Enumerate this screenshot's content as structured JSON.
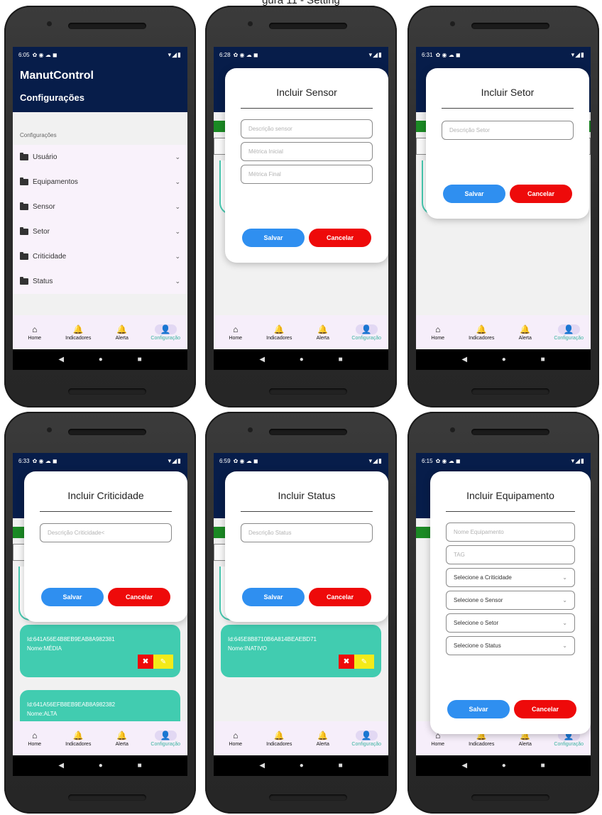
{
  "caption": "gura 11 - Setting",
  "status": {
    "icons_left": "✿ ◉ ☁ ◼",
    "icons_right": "▾◢▮",
    "times": [
      "6:05",
      "6:28",
      "6:31",
      "6:33",
      "6:59",
      "6:15"
    ]
  },
  "app": {
    "title": "ManutControl",
    "subtitle": "Configurações"
  },
  "config": {
    "section_label": "Configurações",
    "items": [
      "Usuário",
      "Equipamentos",
      "Sensor",
      "Setor",
      "Criticidade",
      "Status"
    ]
  },
  "nav": {
    "home": "Home",
    "indicadores": "Indicadores",
    "alerta": "Alerta",
    "configuracao": "Configuração"
  },
  "buttons": {
    "save": "Salvar",
    "cancel": "Cancelar"
  },
  "modals": {
    "sensor": {
      "title": "Incluir Sensor",
      "desc_placeholder": "Descrição sensor",
      "metric_start": "Métrica Inicial",
      "metric_end": "Métrica Final"
    },
    "setor": {
      "title": "Incluir Setor",
      "desc_placeholder": "Descrição Setor"
    },
    "criticidade": {
      "title": "Incluir Criticidade",
      "desc_placeholder": "Descrição Criticidade<"
    },
    "status": {
      "title": "Incluir Status",
      "desc_placeholder": "Descrição Status"
    },
    "equipamento": {
      "title": "Incluir Equipamento",
      "name_placeholder": "Nome Equipamento",
      "tag_placeholder": "TAG",
      "sel_criticidade": "Selecione a Criticidade",
      "sel_sensor": "Selecione o Sensor",
      "sel_setor": "Selecione o Setor",
      "sel_status": "Selecione o Status"
    }
  },
  "cards": {
    "crit1": {
      "id": "Id:641A56E4B8EB9EAB8A982381",
      "name": "Nome:MÉDIA"
    },
    "crit2": {
      "id": "Id:641A56EFB8EB9EAB8A982382",
      "name": "Nome:ALTA"
    },
    "status1": {
      "id": "Id:645E8B8710B6A814BEAEBD71",
      "name": "Nome:INATIVO"
    }
  },
  "icons": {
    "home": "⌂",
    "bell": "🔔",
    "person": "👤",
    "back": "◀",
    "circle": "●",
    "square": "■",
    "close": "✖",
    "edit": "✎"
  },
  "colors": {
    "header": "#071d4a",
    "accent": "#41ccb0",
    "save": "#2f8ff0",
    "cancel": "#ee0a0a"
  }
}
